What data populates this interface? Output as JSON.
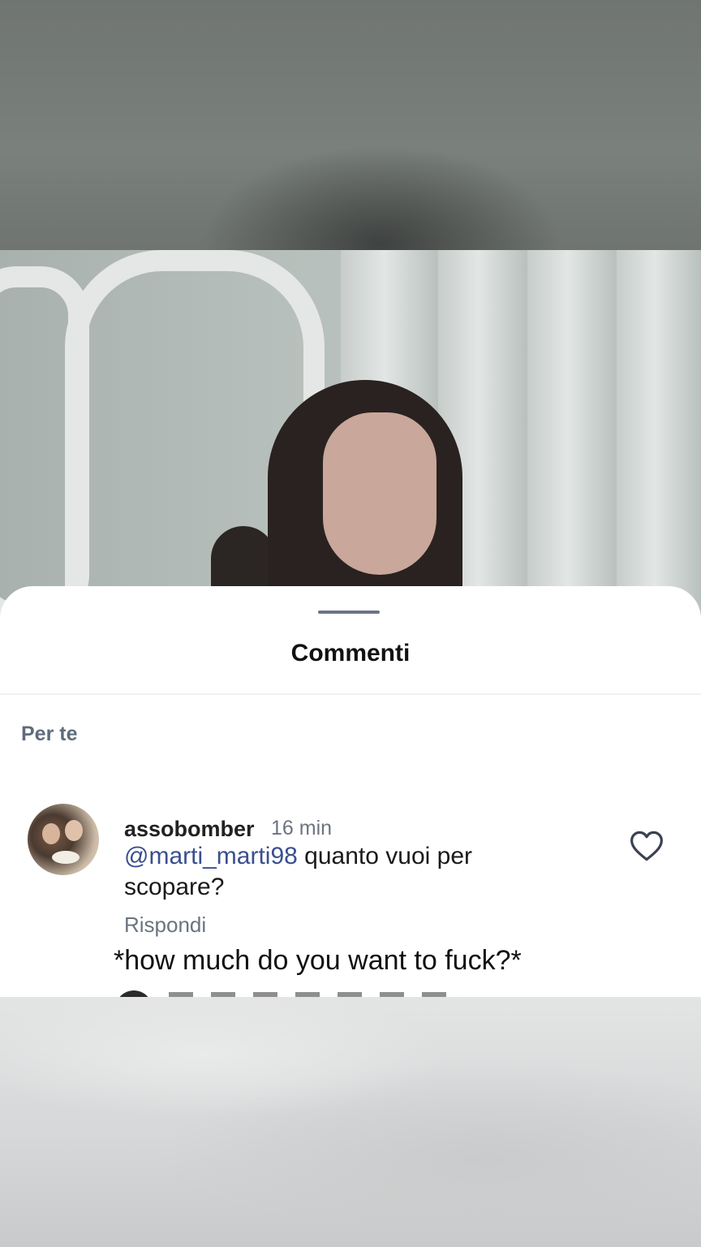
{
  "sheet": {
    "title": "Commenti",
    "section_label": "Per te"
  },
  "comment": {
    "username": "assobomber",
    "time": "16 min",
    "mention": "@marti_marti98",
    "text": " quanto vuoi per scopare?",
    "reply_label": "Rispondi",
    "like_icon": "heart-icon"
  },
  "translation": "*how much do you want to fuck?*",
  "colors": {
    "mention": "#3b4f8f",
    "secondary_text": "#6b7480",
    "handle": "#6a7487"
  }
}
